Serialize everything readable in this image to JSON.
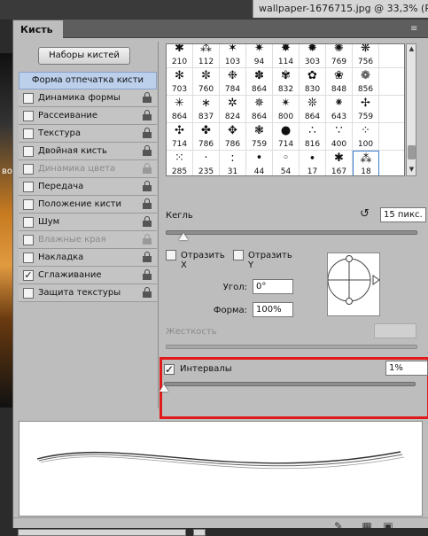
{
  "document": {
    "tab_title": "wallpaper-1676715.jpg @ 33,3% (RGB"
  },
  "background_photo_text": "во",
  "panel": {
    "title": "Кисть",
    "brush_sets_label": "Наборы кистей",
    "header_item": "Форма отпечатка кисти",
    "items": [
      {
        "label": "Динамика формы",
        "checked": false,
        "dim": false
      },
      {
        "label": "Рассеивание",
        "checked": false,
        "dim": false
      },
      {
        "label": "Текстура",
        "checked": false,
        "dim": false
      },
      {
        "label": "Двойная кисть",
        "checked": false,
        "dim": false
      },
      {
        "label": "Динамика цвета",
        "checked": false,
        "dim": true
      },
      {
        "label": "Передача",
        "checked": false,
        "dim": false
      },
      {
        "label": "Положение кисти",
        "checked": false,
        "dim": false
      },
      {
        "label": "Шум",
        "checked": false,
        "dim": false
      },
      {
        "label": "Влажные края",
        "checked": false,
        "dim": true
      },
      {
        "label": "Накладка",
        "checked": false,
        "dim": false
      },
      {
        "label": "Сглаживание",
        "checked": true,
        "dim": false
      },
      {
        "label": "Защита текстуры",
        "checked": false,
        "dim": false
      }
    ],
    "brush_grid": [
      [
        "210",
        "112",
        "103",
        "94",
        "114",
        "303",
        "769",
        "756"
      ],
      [
        "703",
        "760",
        "784",
        "864",
        "832",
        "830",
        "848",
        "856"
      ],
      [
        "864",
        "837",
        "824",
        "864",
        "800",
        "864",
        "643",
        "759"
      ],
      [
        "714",
        "786",
        "786",
        "759",
        "714",
        "816",
        "400",
        "100"
      ],
      [
        "285",
        "235",
        "31",
        "44",
        "54",
        "17",
        "167",
        "18"
      ]
    ],
    "selected_brush": "18",
    "size_label": "Кегль",
    "size_value": "15 пикс.",
    "size_slider_fraction": 0.07,
    "flip_x_label": "Отразить X",
    "flip_y_label": "Отразить Y",
    "angle_label": "Угол:",
    "angle_value": "0°",
    "roundness_label": "Форма:",
    "roundness_value": "100%",
    "hardness_label": "Жесткость",
    "hardness_value": "",
    "spacing_label": "Интервалы",
    "spacing_checked": true,
    "spacing_value": "1%",
    "spacing_slider_fraction": 0.0,
    "check_mark": "✓"
  },
  "colors": {
    "highlight": "#e01a1a",
    "header_blue": "#bcd0ec",
    "panel_bg": "#bdbdbd"
  },
  "icons": {
    "reset": "↺",
    "menu": "≡",
    "collapse": "»"
  }
}
